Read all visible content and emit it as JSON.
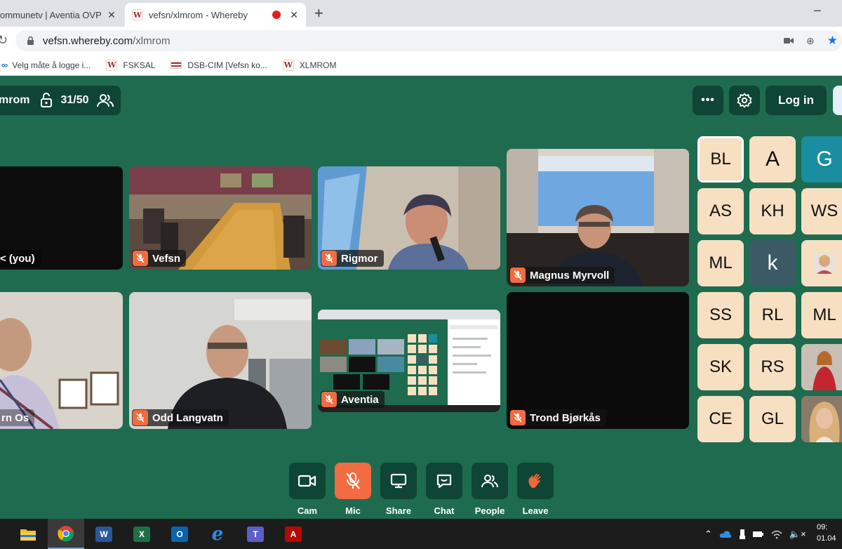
{
  "browser": {
    "tabs": [
      {
        "title": "ommunetv | Aventia OVP",
        "close": "✕"
      },
      {
        "title": "vefsn/xlmrom - Whereby",
        "close": "✕"
      }
    ],
    "new_tab": "+",
    "minimize": "–",
    "url_host": "vefsn.whereby.com",
    "url_path": "/xlmrom",
    "bookmarks": [
      {
        "icon": "oo",
        "label": "Velg måte å logge i..."
      },
      {
        "icon": "W",
        "label": "FSKSAL"
      },
      {
        "icon": "flag",
        "label": "DSB-CIM [Vefsn ko..."
      },
      {
        "icon": "W",
        "label": "XLMROM"
      }
    ]
  },
  "room": {
    "name": "mrom",
    "count": "31/50",
    "more": "•••",
    "login": "Log in"
  },
  "tiles": [
    {
      "name": "< (you)"
    },
    {
      "name": "Vefsn"
    },
    {
      "name": "Rigmor"
    },
    {
      "name": "Magnus Myrvoll"
    },
    {
      "name": "rn Os"
    },
    {
      "name": "Odd Langvatn"
    },
    {
      "name": "Aventia"
    },
    {
      "name": "Trond Bjørkås"
    }
  ],
  "avatars": [
    {
      "initials": "BL"
    },
    {
      "initials": "A"
    },
    {
      "initials": "G"
    },
    {
      "initials": "AS"
    },
    {
      "initials": "KH"
    },
    {
      "initials": "WS"
    },
    {
      "initials": "ML"
    },
    {
      "initials": "k"
    },
    {
      "initials": ""
    },
    {
      "initials": "SS"
    },
    {
      "initials": "RL"
    },
    {
      "initials": "ML"
    },
    {
      "initials": "SK"
    },
    {
      "initials": "RS"
    },
    {
      "initials": ""
    },
    {
      "initials": "CE"
    },
    {
      "initials": "GL"
    },
    {
      "initials": ""
    }
  ],
  "controls": [
    {
      "label": "Cam"
    },
    {
      "label": "Mic"
    },
    {
      "label": "Share"
    },
    {
      "label": "Chat"
    },
    {
      "label": "People"
    },
    {
      "label": "Leave"
    }
  ],
  "taskbar": {
    "apps": [
      "file-explorer",
      "chrome",
      "word",
      "excel",
      "outlook",
      "internet-explorer",
      "teams",
      "acrobat"
    ],
    "time": "09:",
    "date": "01.04"
  },
  "colors": {
    "room_bg": "#1e6b50",
    "panel": "#0f4534",
    "mute_orange": "#f26b41",
    "avatar_peach": "#f7dfc1",
    "avatar_teal": "#1a8ea0",
    "avatar_slate": "#3c5a66"
  }
}
